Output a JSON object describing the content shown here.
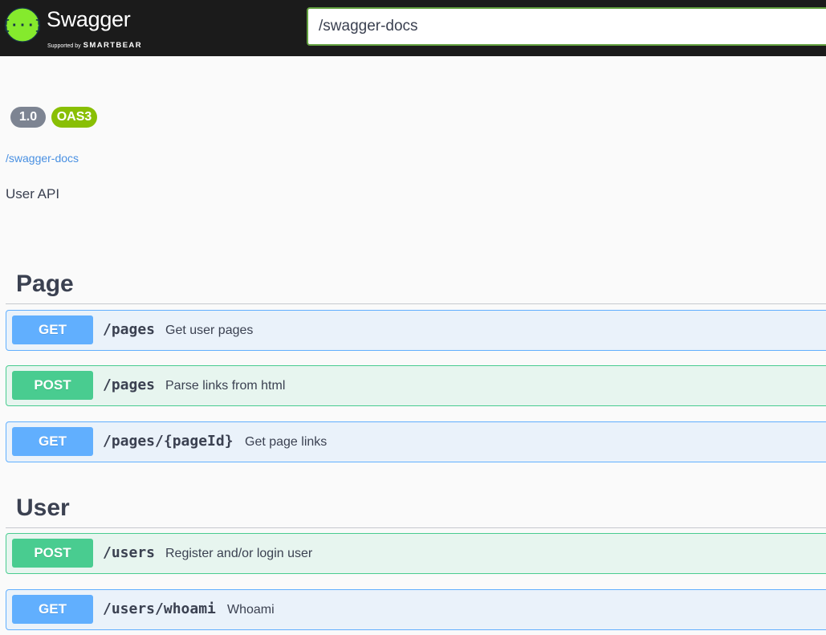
{
  "header": {
    "logo_title": "Swagger",
    "logo_supported": "Supported by",
    "logo_brand": "SMARTBEAR",
    "url_value": "/swagger-docs"
  },
  "info": {
    "version": "1.0",
    "oas": "OAS3",
    "base_url": "/swagger-docs",
    "description": "User API"
  },
  "tags": [
    {
      "name": "Page",
      "operations": [
        {
          "method": "GET",
          "path": "/pages",
          "summary": "Get user pages"
        },
        {
          "method": "POST",
          "path": "/pages",
          "summary": "Parse links from html"
        },
        {
          "method": "GET",
          "path": "/pages/{pageId}",
          "summary": "Get page links"
        }
      ]
    },
    {
      "name": "User",
      "operations": [
        {
          "method": "POST",
          "path": "/users",
          "summary": "Register and/or login user"
        },
        {
          "method": "GET",
          "path": "/users/whoami",
          "summary": "Whoami"
        }
      ]
    }
  ],
  "colors": {
    "topbar": "#1b1b1b",
    "get": "#61affe",
    "post": "#49cc90",
    "oas_badge": "#89bf04",
    "version_badge": "#7d8492",
    "logo_green": "#85ea2d"
  }
}
